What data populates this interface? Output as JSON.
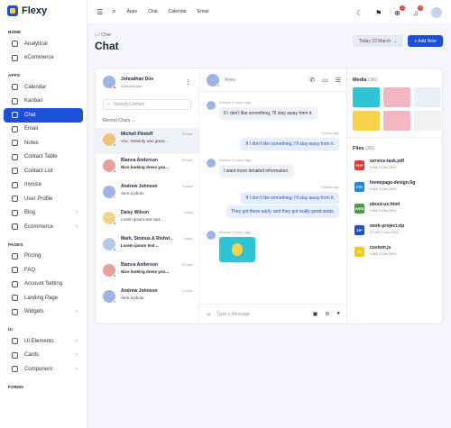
{
  "app": {
    "name": "Flexy"
  },
  "sidebar": {
    "sections": [
      {
        "title": "HOME",
        "items": [
          {
            "label": "Analytical"
          },
          {
            "label": "eCommerce"
          }
        ]
      },
      {
        "title": "APPS",
        "items": [
          {
            "label": "Calendar"
          },
          {
            "label": "Kanban"
          },
          {
            "label": "Chat",
            "active": true
          },
          {
            "label": "Email"
          },
          {
            "label": "Notes"
          },
          {
            "label": "Contact Table"
          },
          {
            "label": "Contact List"
          },
          {
            "label": "Invoice"
          },
          {
            "label": "User Profile"
          },
          {
            "label": "Blog",
            "chevron": true
          },
          {
            "label": "Ecommerce",
            "chevron": true
          }
        ]
      },
      {
        "title": "PAGES",
        "items": [
          {
            "label": "Pricing"
          },
          {
            "label": "FAQ"
          },
          {
            "label": "Account Setting"
          },
          {
            "label": "Landing Page"
          },
          {
            "label": "Widgets",
            "chevron": true
          }
        ]
      },
      {
        "title": "UI",
        "items": [
          {
            "label": "UI Elements",
            "chevron": true
          },
          {
            "label": "Cards",
            "chevron": true
          },
          {
            "label": "Component",
            "chevron": true
          }
        ]
      },
      {
        "title": "FORMS",
        "items": []
      }
    ]
  },
  "topbar": {
    "links": [
      "Apps",
      "Chat",
      "Calendar",
      "Email"
    ],
    "badges": {
      "cart": "2",
      "bell": "5"
    }
  },
  "header": {
    "breadcrumb_home": "⌂",
    "breadcrumb_sep": "/",
    "breadcrumb": "Chat",
    "title": "Chat",
    "date": "Today 23 March",
    "add_label": "+ Add New"
  },
  "me": {
    "name": "Johnathan Doe",
    "role": "Administrator"
  },
  "search": {
    "placeholder": "Search Contact"
  },
  "recent_label": "Recent Chats",
  "chats": [
    {
      "name": "Michell Flintoff",
      "msg": "You: Yesterdy was great...",
      "time": "15 mins",
      "color": "#f0c37a",
      "dot": "#2ecc71",
      "bold": false
    },
    {
      "name": "Bianca Anderson",
      "msg": "Nice looking dress you...",
      "time": "30 mins",
      "color": "#e9a0a0",
      "dot": "#2ecc71",
      "bold": true
    },
    {
      "name": "Andrew Johnson",
      "msg": "Sent a photo",
      "time": "2 hours",
      "color": "#9fb4e6",
      "dot": "#f1c40f",
      "bold": false
    },
    {
      "name": "Daisy Wilson",
      "msg": "Lorem ipsum text sad...",
      "time": "5 days",
      "color": "#f3d28a",
      "dot": "#2ecc71",
      "bold": false
    },
    {
      "name": "Mark, Stoinus & Rishvi..",
      "msg": "Lorem ipsum text ...",
      "time": "5 days",
      "color": "#b9c7e8",
      "dot": "#2ecc71",
      "bold": true
    },
    {
      "name": "Bianca Anderson",
      "msg": "Nice looking dress you...",
      "time": "30 mins",
      "color": "#e9a0a0",
      "dot": "#2ecc71",
      "bold": true
    },
    {
      "name": "Andrew Johnson",
      "msg": "Sent a photo",
      "time": "2 hours",
      "color": "#9fb4e6",
      "dot": "#f1c40f",
      "bold": false
    }
  ],
  "conversation": {
    "status": "Away",
    "messages": [
      {
        "side": "left",
        "meta": "Andrew, 2 hours ago",
        "text": "If I don't like something, I'll stay away from it."
      },
      {
        "side": "right",
        "meta": "2 hours ago",
        "text": "If I don't like something, I'll stay away from it."
      },
      {
        "side": "left",
        "meta": "Andrew, 2 hours ago",
        "text": "I want more detailed information."
      },
      {
        "side": "right",
        "meta": "2 hours ago",
        "text": "If I don't like something, I'll stay away from it."
      },
      {
        "side": "right",
        "meta": "",
        "text": "They got there early, and they got really good seats."
      },
      {
        "side": "left",
        "meta": "Andrew, 2 hours ago",
        "text": ""
      }
    ],
    "input_placeholder": "Type a Message"
  },
  "media": {
    "title": "Media",
    "count": "(36)",
    "tiles": [
      "#2ec4d6",
      "#f3b6c3",
      "#e9f0f7",
      "#f6d24a",
      "#f3b6c3",
      "#f0f0f0"
    ]
  },
  "files": {
    "title": "Files",
    "count": "(36)",
    "items": [
      {
        "name": "service-task.pdf",
        "meta": "2 MB   2 Dec 2024",
        "color": "#e53935",
        "ext": "PDF"
      },
      {
        "name": "homepage-design.fig",
        "meta": "3 MB   2 Dec 2024",
        "color": "#1e88e5",
        "ext": "FIG"
      },
      {
        "name": "about-us.html",
        "meta": "1 MB   2 Dec 2024",
        "color": "#43a047",
        "ext": "WEB"
      },
      {
        "name": "work-project.zip",
        "meta": "20 MB   2 Dec 2024",
        "color": "#1e4fd8",
        "ext": "ZIP"
      },
      {
        "name": "custom.js",
        "meta": "2 MB   2 Dec 2024",
        "color": "#f6c90e",
        "ext": "JS"
      }
    ]
  }
}
